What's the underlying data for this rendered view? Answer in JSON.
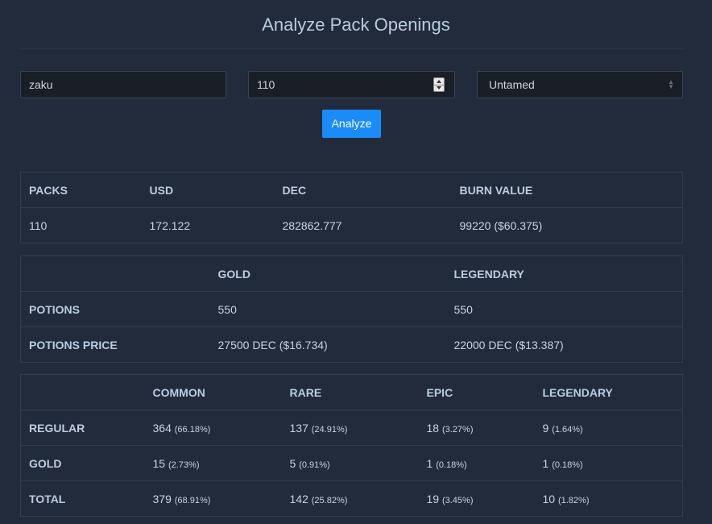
{
  "title": "Analyze Pack Openings",
  "form": {
    "username": "zaku",
    "packs": "110",
    "edition": "Untamed",
    "analyze_label": "Analyze"
  },
  "summary": {
    "headers": [
      "PACKS",
      "USD",
      "DEC",
      "BURN VALUE"
    ],
    "row": [
      "110",
      "172.122",
      "282862.777",
      "99220 ($60.375)"
    ]
  },
  "potions": {
    "headers": [
      "",
      "GOLD",
      "LEGENDARY"
    ],
    "rows": [
      {
        "label": "POTIONS",
        "gold": "550",
        "legendary": "550"
      },
      {
        "label": "POTIONS PRICE",
        "gold": "27500 DEC ($16.734)",
        "legendary": "22000 DEC ($13.387)"
      }
    ]
  },
  "rarity": {
    "headers": [
      "",
      "COMMON",
      "RARE",
      "EPIC",
      "LEGENDARY"
    ],
    "rows": [
      {
        "label": "REGULAR",
        "cells": [
          {
            "count": "364",
            "pct": "(66.18%)"
          },
          {
            "count": "137",
            "pct": "(24.91%)"
          },
          {
            "count": "18",
            "pct": "(3.27%)"
          },
          {
            "count": "9",
            "pct": "(1.64%)"
          }
        ]
      },
      {
        "label": "GOLD",
        "cells": [
          {
            "count": "15",
            "pct": "(2.73%)"
          },
          {
            "count": "5",
            "pct": "(0.91%)"
          },
          {
            "count": "1",
            "pct": "(0.18%)"
          },
          {
            "count": "1",
            "pct": "(0.18%)"
          }
        ]
      },
      {
        "label": "TOTAL",
        "cells": [
          {
            "count": "379",
            "pct": "(68.91%)"
          },
          {
            "count": "142",
            "pct": "(25.82%)"
          },
          {
            "count": "19",
            "pct": "(3.45%)"
          },
          {
            "count": "10",
            "pct": "(1.82%)"
          }
        ]
      }
    ]
  },
  "colors": {
    "background": "#222b3b",
    "accent": "#1a8cf8",
    "heading": "#b9cde2"
  }
}
